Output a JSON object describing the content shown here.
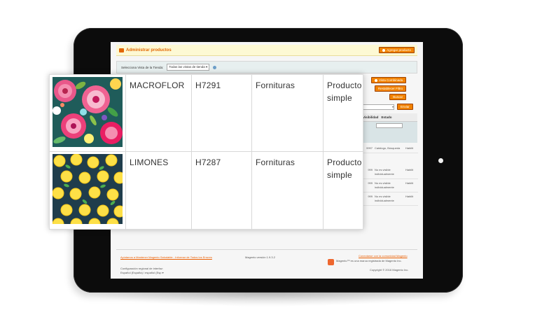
{
  "admin": {
    "page_title": "Administrar productos",
    "add_product_button": "Agregar producto",
    "store_view_label": "Selecciona Vista de la Tienda:",
    "store_view_value": "Todas las vistas de tienda",
    "grid_buttons": [
      "Vista Combinada",
      "Restablecer Filtro",
      "Buscar"
    ],
    "send_button": "Enviar",
    "grid_columns": [
      "Visibilidad",
      "Estado"
    ],
    "rows": [
      {
        "qty": "9997",
        "visibility": "Catálogo, Búsqueda",
        "status": "Habilit"
      },
      {
        "qty": "999",
        "visibility": "No es visible individualmente",
        "status": "Habilit"
      },
      {
        "qty": "999",
        "visibility": "No es visible individualmente",
        "status": "Habilit"
      },
      {
        "qty": "999",
        "visibility": "No es visible individualmente",
        "status": "Habilit"
      }
    ],
    "footer": {
      "help_link": "Ayúdanos a Mantener Magento Saludable - Informar de Todos los Errores",
      "locale_label": "Configuración regional de interfaz:",
      "locale_value": "Español (España) / español (Esp",
      "version": "Magento versión 1.9.3.2",
      "community_link": "Conectarse con la comunidad Magento",
      "trademark": "Magento™ es una marca registrada de Magento Inc.",
      "copyright": "Copyright © 2016 Magento Inc."
    }
  },
  "products": [
    {
      "name": "MACROFLOR",
      "sku": "H7291",
      "attribute_set": "Fornituras",
      "type": "Producto simple",
      "swatch": "floral-pattern"
    },
    {
      "name": "LIMONES",
      "sku": "H7287",
      "attribute_set": "Fornituras",
      "type": "Producto simple",
      "swatch": "lemon-pattern"
    }
  ],
  "colors": {
    "accent": "#f18200",
    "header_bg": "#fdf9d4",
    "tablet": "#0c0c0c"
  }
}
